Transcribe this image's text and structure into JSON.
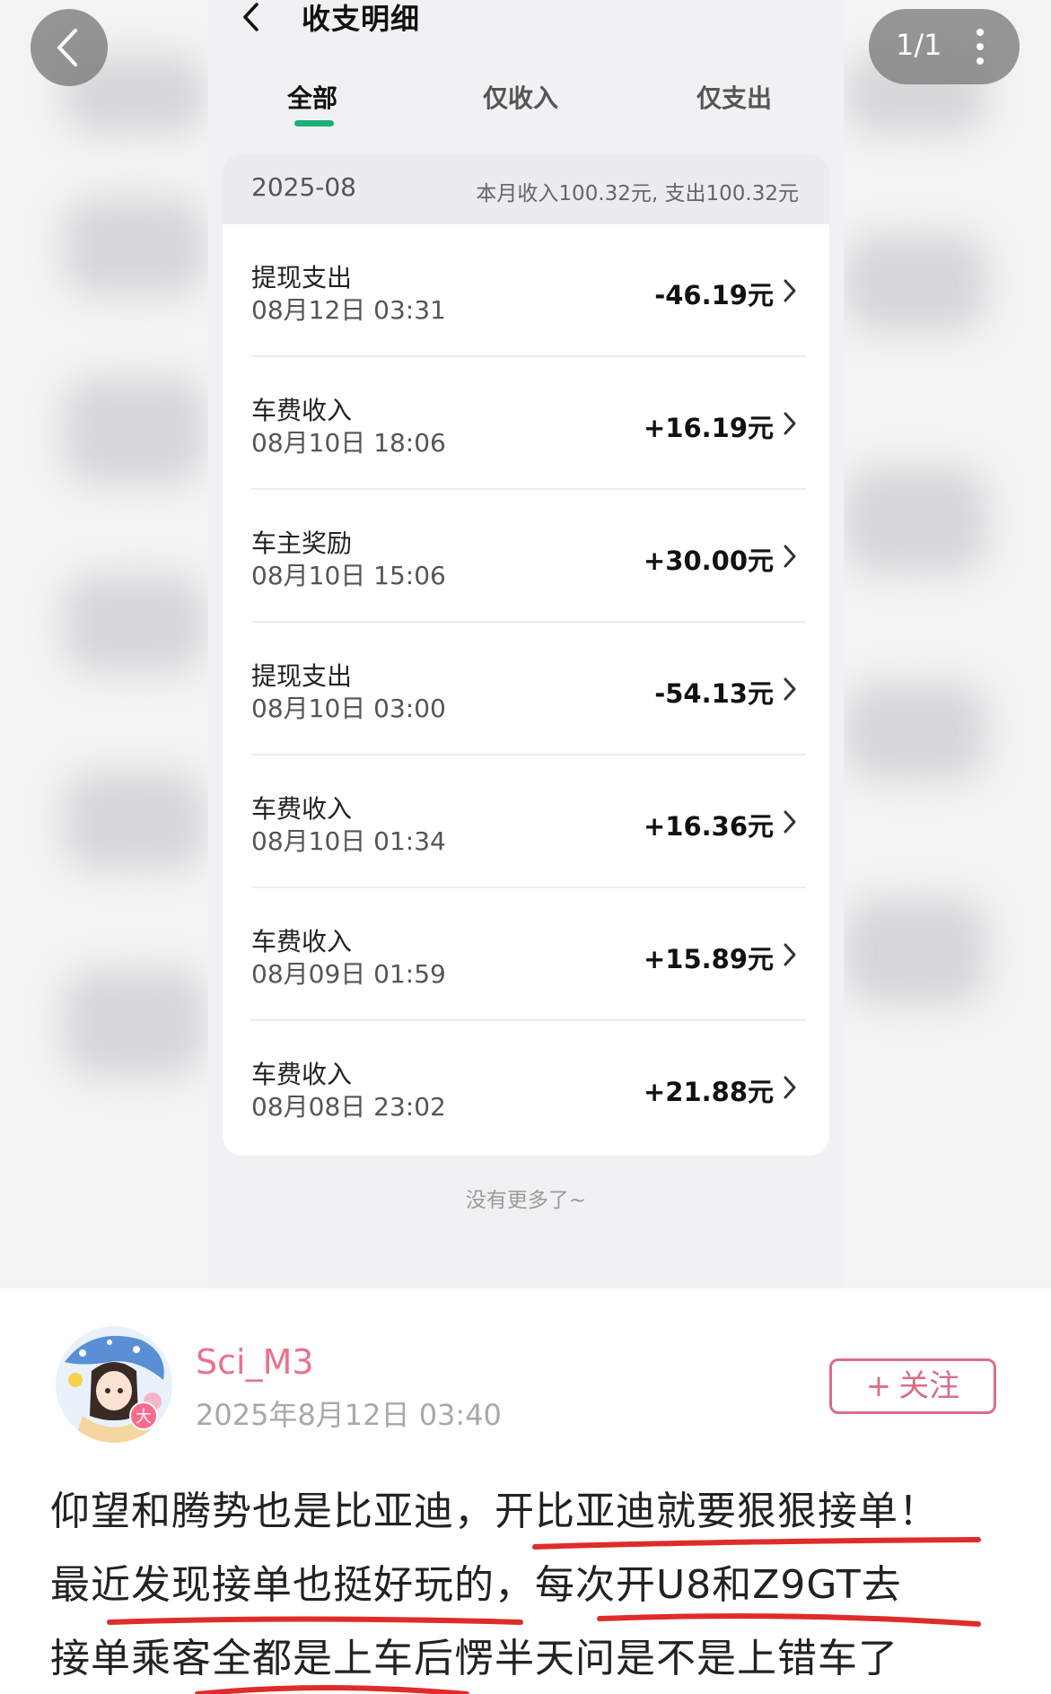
{
  "viewer": {
    "page_counter": "1/1"
  },
  "screenshot": {
    "title": "收支明细",
    "tabs": [
      {
        "label": "全部",
        "active": true
      },
      {
        "label": "仅收入",
        "active": false
      },
      {
        "label": "仅支出",
        "active": false
      }
    ],
    "month": {
      "label": "2025-08",
      "summary": "本月收入100.32元, 支出100.32元"
    },
    "transactions": [
      {
        "name": "提现支出",
        "time": "08月12日 03:31",
        "amount": "-46.19元"
      },
      {
        "name": "车费收入",
        "time": "08月10日 18:06",
        "amount": "+16.19元"
      },
      {
        "name": "车主奖励",
        "time": "08月10日 15:06",
        "amount": "+30.00元"
      },
      {
        "name": "提现支出",
        "time": "08月10日 03:00",
        "amount": "-54.13元"
      },
      {
        "name": "车费收入",
        "time": "08月10日 01:34",
        "amount": "+16.36元"
      },
      {
        "name": "车费收入",
        "time": "08月09日 01:59",
        "amount": "+15.89元"
      },
      {
        "name": "车费收入",
        "time": "08月08日 23:02",
        "amount": "+21.88元"
      }
    ],
    "no_more": "没有更多了~",
    "accent_color": "#1fb07a"
  },
  "post": {
    "username": "Sci_M3",
    "time": "2025年8月12日 03:40",
    "follow_plus": "+",
    "follow_label": "关注",
    "avatar_badge": "大",
    "body_lines": [
      "仰望和腾势也是比亚迪，开比亚迪就要狠狠接单！",
      "最近发现接单也挺好玩的，每次开U8和Z9GT去",
      "接单乘客全都是上车后愣半天问是不是上错车了"
    ],
    "username_color": "#e8738f",
    "underline_color": "#e02b2b"
  }
}
